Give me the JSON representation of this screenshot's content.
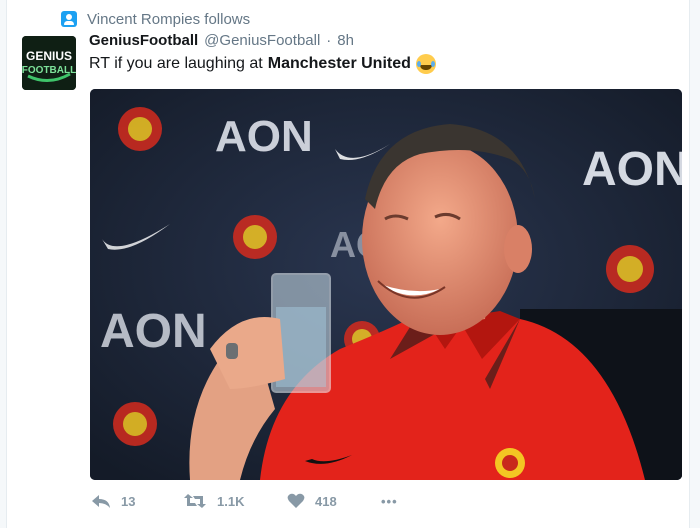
{
  "context": {
    "text": "Vincent Rompies follows",
    "icon": "follow-user-icon"
  },
  "avatar": {
    "logo_line1": "GENIUS",
    "logo_line2": "FOOTBALL"
  },
  "author": {
    "name": "GeniusFootball",
    "handle": "@GeniusFootball",
    "separator": "·",
    "time": "8h"
  },
  "tweet": {
    "text_before": "RT if you are laughing at",
    "text_bold": "Manchester United",
    "emoji": "face-with-tears-of-joy"
  },
  "media": {
    "backdrop_words": [
      "AON",
      "AON",
      "AON",
      "AON"
    ],
    "description_icon": "photo"
  },
  "actions": {
    "reply_count": "13",
    "retweet_count": "1.1K",
    "like_count": "418",
    "more_label": "•••"
  },
  "colors": {
    "accent": "#1da1f2",
    "muted": "#657786",
    "action_gray": "#8899a6",
    "shirt_red": "#e3231b"
  }
}
